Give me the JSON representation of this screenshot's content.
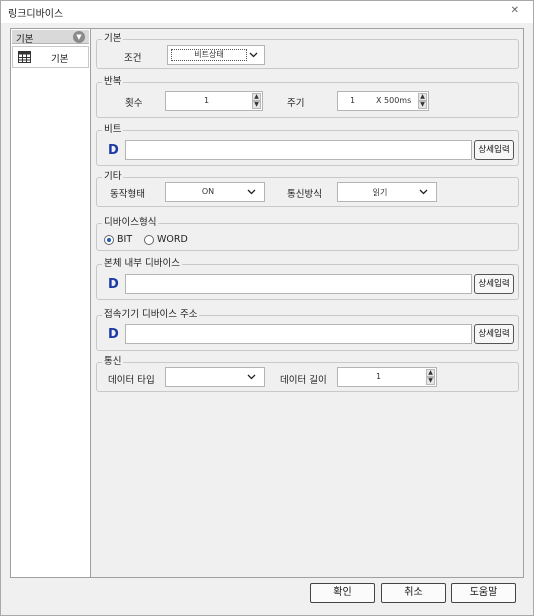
{
  "window": {
    "title": "링크디바이스",
    "close_icon": "close-icon"
  },
  "sidebar": {
    "header_label": "기본",
    "items": [
      {
        "label": "기본",
        "icon": "grid-table-icon"
      }
    ]
  },
  "basic": {
    "legend": "기본",
    "condition_label": "조건",
    "condition_value": "비트상태"
  },
  "repeat": {
    "legend": "반복",
    "count_label": "횟수",
    "count_value": "1",
    "period_label": "주기",
    "period_value": "1",
    "period_unit": "X 500ms"
  },
  "bit": {
    "legend": "비트",
    "device_prefix": "D",
    "value": "",
    "detail_button": "상세입력"
  },
  "etc": {
    "legend": "기타",
    "operation_label": "동작형태",
    "operation_value": "ON",
    "comm_label": "통신방식",
    "comm_value": "읽기"
  },
  "device_format": {
    "legend": "디바이스형식",
    "options": [
      {
        "label": "BIT",
        "checked": true
      },
      {
        "label": "WORD",
        "checked": false
      }
    ]
  },
  "internal_device": {
    "legend": "본체 내부 디바이스",
    "device_prefix": "D",
    "value": "",
    "detail_button": "상세입력"
  },
  "connected_device": {
    "legend": "접속기기 디바이스 주소",
    "device_prefix": "D",
    "value": "",
    "detail_button": "상세입력"
  },
  "communication": {
    "legend": "통신",
    "data_type_label": "데이터 타입",
    "data_type_value": "",
    "data_length_label": "데이터 길이",
    "data_length_value": "1"
  },
  "footer": {
    "ok": "확인",
    "cancel": "취소",
    "help": "도움말"
  }
}
